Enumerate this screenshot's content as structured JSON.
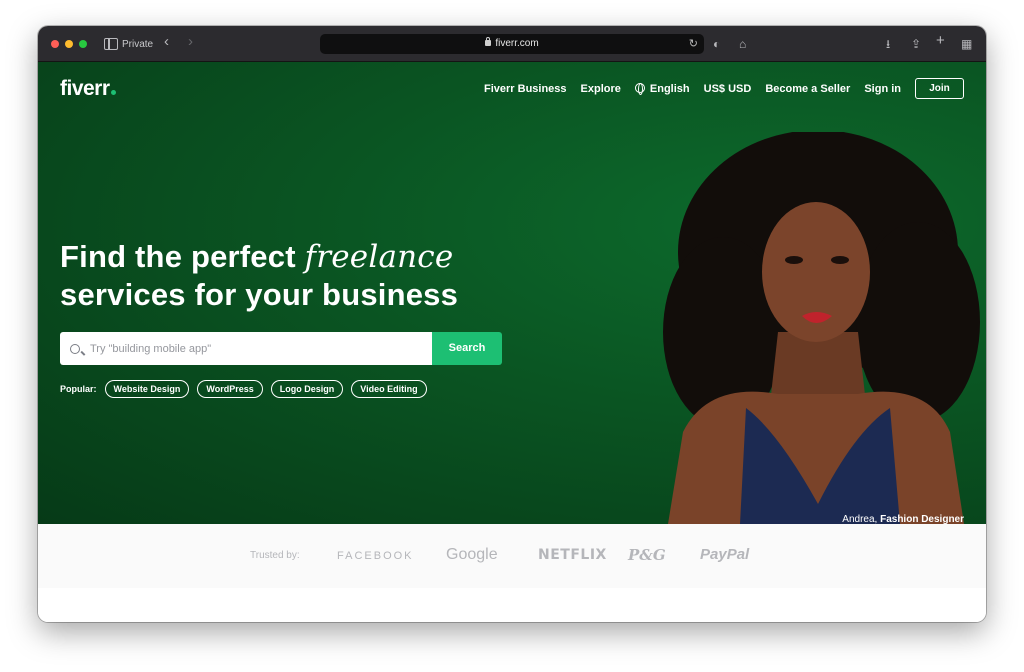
{
  "browser": {
    "private_label": "Private",
    "url": "fiverr.com"
  },
  "header": {
    "logo": "fiverr",
    "nav": {
      "business": "Fiverr Business",
      "explore": "Explore",
      "language": "English",
      "currency": "US$ USD",
      "become_seller": "Become a Seller",
      "sign_in": "Sign in",
      "join": "Join"
    }
  },
  "hero": {
    "headline_line1": "Find the perfect",
    "headline_em": "freelance",
    "headline_line2": "services for your business",
    "search_placeholder": "Try \"building mobile app\"",
    "search_button": "Search",
    "popular_label": "Popular:",
    "popular_tags": [
      "Website Design",
      "WordPress",
      "Logo Design",
      "Video Editing"
    ],
    "caption_name": "Andrea,",
    "caption_role": "Fashion Designer"
  },
  "trusted": {
    "label": "Trusted by:",
    "brands": [
      "FACEBOOK",
      "Google",
      "NETFLIX",
      "P&G",
      "PayPal"
    ]
  },
  "colors": {
    "hero_green": "#0a5422",
    "accent_green": "#1dbf73"
  }
}
